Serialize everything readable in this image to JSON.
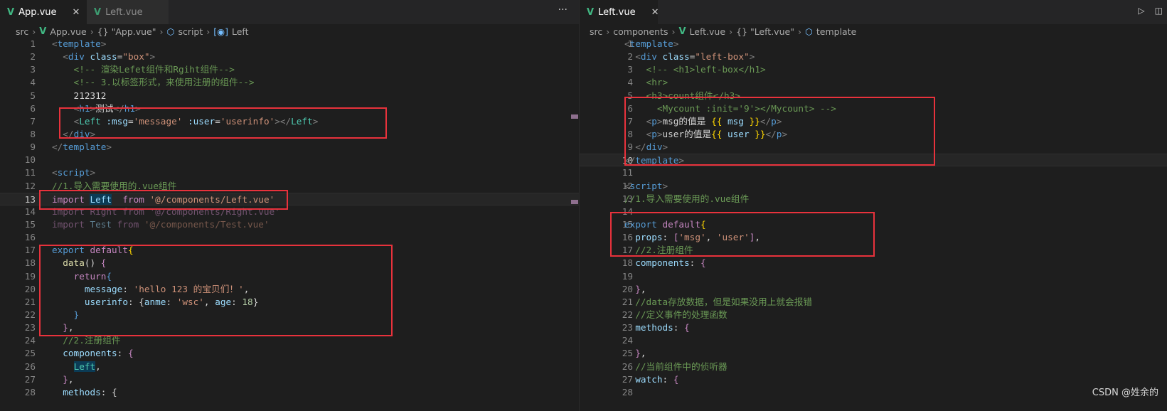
{
  "left": {
    "tabs": [
      {
        "label": "App.vue",
        "active": true,
        "close": "✕"
      },
      {
        "label": "Left.vue",
        "active": false
      }
    ],
    "more": "···",
    "breadcrumb": [
      "src",
      "App.vue",
      "{} \"App.vue\"",
      "script",
      "Left"
    ],
    "lines": [
      [
        [
          "<",
          "br"
        ],
        [
          "template",
          "tg"
        ],
        [
          ">",
          "br"
        ]
      ],
      [
        [
          "  ",
          "tx"
        ],
        [
          "<",
          "br"
        ],
        [
          "div",
          "tg"
        ],
        [
          " class",
          "at"
        ],
        [
          "=",
          "tx"
        ],
        [
          "\"box\"",
          "st"
        ],
        [
          ">",
          "br"
        ]
      ],
      [
        [
          "    <!-- 渲染Lefet组件和Rgiht组件-->",
          "cm"
        ]
      ],
      [
        [
          "    <!-- 3.以标签形式，来使用注册的组件-->",
          "cm"
        ]
      ],
      [
        [
          "    212312",
          "tx"
        ]
      ],
      [
        [
          "    ",
          "tx"
        ],
        [
          "<",
          "br"
        ],
        [
          "h1",
          "tg"
        ],
        [
          ">",
          "br"
        ],
        [
          "测试",
          "tx"
        ],
        [
          "</",
          "br"
        ],
        [
          "h1",
          "tg"
        ],
        [
          ">",
          "br"
        ]
      ],
      [
        [
          "    ",
          "tx"
        ],
        [
          "<",
          "br"
        ],
        [
          "Left",
          "cp"
        ],
        [
          " :msg",
          "at"
        ],
        [
          "=",
          "tx"
        ],
        [
          "'message'",
          "st"
        ],
        [
          " :user",
          "at"
        ],
        [
          "=",
          "tx"
        ],
        [
          "'userinfo'",
          "st"
        ],
        [
          "></",
          "br"
        ],
        [
          "Left",
          "cp"
        ],
        [
          ">",
          "br"
        ]
      ],
      [
        [
          "  ",
          "tx"
        ],
        [
          "</",
          "br"
        ],
        [
          "div",
          "tg"
        ],
        [
          ">",
          "br"
        ]
      ],
      [
        [
          "</",
          "br"
        ],
        [
          "template",
          "tg"
        ],
        [
          ">",
          "br"
        ]
      ],
      [
        [
          "",
          "tx"
        ]
      ],
      [
        [
          "<",
          "br"
        ],
        [
          "script",
          "tg"
        ],
        [
          ">",
          "br"
        ]
      ],
      [
        [
          "//1.导入需要使用的.vue组件",
          "cm"
        ]
      ],
      [
        [
          "import ",
          "kw"
        ],
        [
          "Left",
          "hl va"
        ],
        [
          "  from ",
          "kw"
        ],
        [
          "'@/components/Left.vue'",
          "st"
        ]
      ],
      [
        [
          "import Right from '@/components/Right.vue'",
          "kw dm"
        ]
      ],
      [
        [
          "import ",
          "kw dm"
        ],
        [
          "Test",
          "va dm"
        ],
        [
          " from ",
          "kw dm"
        ],
        [
          "'@/components/Test.vue'",
          "st dm"
        ]
      ],
      [
        [
          "",
          "tx"
        ]
      ],
      [
        [
          "export ",
          "kb"
        ],
        [
          "default",
          "kw"
        ],
        [
          "{",
          "yb"
        ]
      ],
      [
        [
          "  ",
          "tx"
        ],
        [
          "data",
          "fn"
        ],
        [
          "() ",
          "tx"
        ],
        [
          "{",
          "kw"
        ]
      ],
      [
        [
          "    ",
          "tx"
        ],
        [
          "return",
          "kw"
        ],
        [
          "{",
          "kb"
        ]
      ],
      [
        [
          "      ",
          "tx"
        ],
        [
          "message",
          "va"
        ],
        [
          ": ",
          "tx"
        ],
        [
          "'hello 123 的宝贝们！'",
          "st"
        ],
        [
          ",",
          "tx"
        ]
      ],
      [
        [
          "      ",
          "tx"
        ],
        [
          "userinfo",
          "va"
        ],
        [
          ": {",
          "tx"
        ],
        [
          "anme",
          "va"
        ],
        [
          ": ",
          "tx"
        ],
        [
          "'wsc'",
          "st"
        ],
        [
          ", ",
          "tx"
        ],
        [
          "age",
          "va"
        ],
        [
          ": ",
          "tx"
        ],
        [
          "18",
          "nu"
        ],
        [
          "}",
          "tx"
        ]
      ],
      [
        [
          "    }",
          "kb"
        ]
      ],
      [
        [
          "  }",
          "kw"
        ],
        [
          ",",
          "tx"
        ]
      ],
      [
        [
          "  //2.注册组件",
          "cm"
        ]
      ],
      [
        [
          "  ",
          "tx"
        ],
        [
          "components",
          "va"
        ],
        [
          ": ",
          "tx"
        ],
        [
          "{",
          "kw"
        ]
      ],
      [
        [
          "    ",
          "tx"
        ],
        [
          "Left",
          "hl cp"
        ],
        [
          ",",
          "tx"
        ]
      ],
      [
        [
          "  }",
          "kw"
        ],
        [
          ",",
          "tx"
        ]
      ],
      [
        [
          "  ",
          "tx"
        ],
        [
          "methods",
          "va"
        ],
        [
          ": {",
          "tx"
        ]
      ]
    ],
    "current_line": 13
  },
  "right": {
    "tabs": [
      {
        "label": "Left.vue",
        "active": true,
        "close": "✕"
      }
    ],
    "more": "···",
    "actions": [
      "▷",
      "◫"
    ],
    "breadcrumb": [
      "src",
      "components",
      "Left.vue",
      "{} \"Left.vue\"",
      "template"
    ],
    "lines": [
      [
        [
          "<",
          "br"
        ],
        [
          "template",
          "tg"
        ],
        [
          ">",
          "br"
        ]
      ],
      [
        [
          "  ",
          "tx"
        ],
        [
          "<",
          "br"
        ],
        [
          "div",
          "tg"
        ],
        [
          " class",
          "at"
        ],
        [
          "=",
          "tx"
        ],
        [
          "\"left-box\"",
          "st"
        ],
        [
          ">",
          "br"
        ]
      ],
      [
        [
          "    <!-- <h1>left-box</h1>",
          "cm"
        ]
      ],
      [
        [
          "    <hr>",
          "cm"
        ]
      ],
      [
        [
          "    <h3>count组件</h3>",
          "cm"
        ]
      ],
      [
        [
          "      <Mycount :init='9'></Mycount> -->",
          "cm"
        ]
      ],
      [
        [
          "    ",
          "tx"
        ],
        [
          "<",
          "br"
        ],
        [
          "p",
          "tg"
        ],
        [
          ">",
          "br"
        ],
        [
          "msg的值是 ",
          "tx"
        ],
        [
          "{{",
          "yb"
        ],
        [
          " msg ",
          "va"
        ],
        [
          "}}",
          "yb"
        ],
        [
          "</",
          "br"
        ],
        [
          "p",
          "tg"
        ],
        [
          ">",
          "br"
        ]
      ],
      [
        [
          "    ",
          "tx"
        ],
        [
          "<",
          "br"
        ],
        [
          "p",
          "tg"
        ],
        [
          ">",
          "br"
        ],
        [
          "user的值是",
          "tx"
        ],
        [
          "{{",
          "yb"
        ],
        [
          " user ",
          "va"
        ],
        [
          "}}",
          "yb"
        ],
        [
          "</",
          "br"
        ],
        [
          "p",
          "tg"
        ],
        [
          ">",
          "br"
        ]
      ],
      [
        [
          "  ",
          "tx"
        ],
        [
          "</",
          "br"
        ],
        [
          "div",
          "tg"
        ],
        [
          ">",
          "br"
        ]
      ],
      [
        [
          "</",
          "br"
        ],
        [
          "template",
          "tg"
        ],
        [
          ">",
          "br"
        ]
      ],
      [
        [
          "",
          "tx"
        ]
      ],
      [
        [
          "<",
          "br"
        ],
        [
          "script",
          "tg"
        ],
        [
          ">",
          "br"
        ]
      ],
      [
        [
          "//1.导入需要使用的.vue组件",
          "cm"
        ]
      ],
      [
        [
          "",
          "tx"
        ]
      ],
      [
        [
          "export ",
          "kb"
        ],
        [
          "default",
          "kw"
        ],
        [
          "{",
          "yb"
        ]
      ],
      [
        [
          "  ",
          "tx"
        ],
        [
          "props",
          "va"
        ],
        [
          ": ",
          "tx"
        ],
        [
          "[",
          "kw"
        ],
        [
          "'msg'",
          "st"
        ],
        [
          ", ",
          "tx"
        ],
        [
          "'user'",
          "st"
        ],
        [
          "]",
          "kw"
        ],
        [
          ",",
          "tx"
        ]
      ],
      [
        [
          "  //2.注册组件",
          "cm"
        ]
      ],
      [
        [
          "  ",
          "tx"
        ],
        [
          "components",
          "va"
        ],
        [
          ": ",
          "tx"
        ],
        [
          "{",
          "kw"
        ]
      ],
      [
        [
          "",
          "tx"
        ]
      ],
      [
        [
          "  }",
          "kw"
        ],
        [
          ",",
          "tx"
        ]
      ],
      [
        [
          "  //data存放数据，但是如果没用上就会报错",
          "cm"
        ]
      ],
      [
        [
          "  //定义事件的处理函数",
          "cm"
        ]
      ],
      [
        [
          "  ",
          "tx"
        ],
        [
          "methods",
          "va"
        ],
        [
          ": ",
          "tx"
        ],
        [
          "{",
          "kw"
        ]
      ],
      [
        [
          "",
          "tx"
        ]
      ],
      [
        [
          "  }",
          "kw"
        ],
        [
          ",",
          "tx"
        ]
      ],
      [
        [
          "  //当前组件中的侦听器",
          "cm"
        ]
      ],
      [
        [
          "  ",
          "tx"
        ],
        [
          "watch",
          "va"
        ],
        [
          ": ",
          "tx"
        ],
        [
          "{",
          "kw"
        ]
      ],
      [
        [
          "",
          "tx"
        ]
      ]
    ],
    "current_line": 10
  },
  "watermark": "CSDN @姓余的",
  "colors": {
    "highlight_box": "#e8323c",
    "vue_logo": "#41b883"
  }
}
